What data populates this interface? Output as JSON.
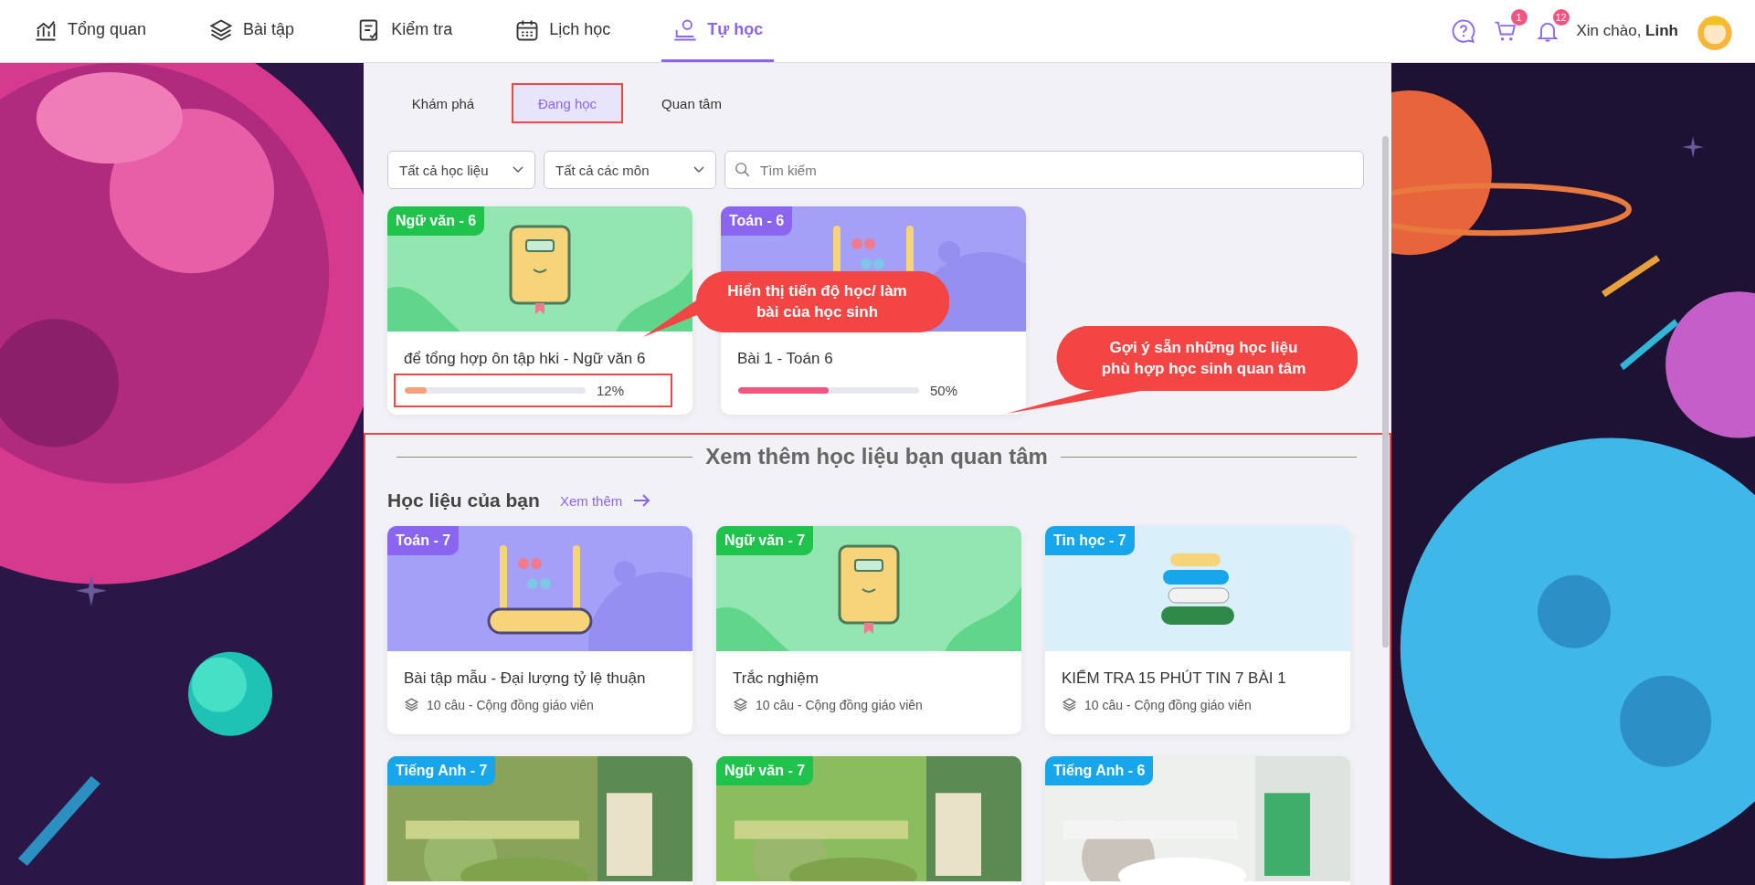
{
  "nav": {
    "items": [
      {
        "label": "Tổng quan",
        "kind": "chart",
        "selected": false
      },
      {
        "label": "Bài tập",
        "kind": "layers",
        "selected": false
      },
      {
        "label": "Kiểm tra",
        "kind": "test",
        "selected": false
      },
      {
        "label": "Lịch học",
        "kind": "calendar",
        "selected": false
      },
      {
        "label": "Tự học",
        "kind": "self",
        "selected": true
      }
    ],
    "cart_count": "1",
    "notification_count": "12",
    "greeting": "Xin chào,",
    "user_name": "Linh"
  },
  "tabs": [
    {
      "label": "Khám phá",
      "selected": false,
      "highlighted": false
    },
    {
      "label": "Đang học",
      "selected": true,
      "highlighted": true
    },
    {
      "label": "Quan tâm",
      "selected": false,
      "highlighted": false
    }
  ],
  "filters": [
    "Tất cả học liệu",
    "Tất cả các môn"
  ],
  "search": {
    "placeholder": "Tìm kiếm"
  },
  "in_progress": [
    {
      "subject": "Ngữ văn - 6",
      "color": "#1fc24a",
      "kind": "book",
      "title": "để tổng hợp ôn tập hki - Ngữ văn 6",
      "progress": {
        "level": 0.12,
        "reading": "12%",
        "color": "#f7a07f",
        "highlighted": true
      }
    },
    {
      "subject": "Toán - 6",
      "color": "#8a66f0",
      "kind": "abacus",
      "title": "Bài 1 - Toán 6",
      "progress": {
        "level": 0.5,
        "reading": "50%",
        "color": "#f2557f",
        "highlighted": false
      }
    }
  ],
  "callouts": [
    "Hiển thị tiến độ học/ làm bài của học sinh",
    "Gợi ý sẵn những học liệu phù hợp học sinh quan tâm"
  ],
  "suggestions": {
    "highlighted": true,
    "heading": "Xem thêm học liệu bạn quan tâm",
    "subheading": "Học liệu của bạn",
    "see_more": "Xem thêm",
    "items": [
      {
        "subject": "Toán - 7",
        "color": "#8a66f0",
        "kind": "abacus",
        "title": "Bài tập mẫu - Đại lượng tỷ lệ thuận",
        "meta": "10 câu - Cộng đồng giáo viên"
      },
      {
        "subject": "Ngữ văn - 7",
        "color": "#1fc24a",
        "kind": "book",
        "title": "Trắc nghiệm",
        "meta": "10 câu - Cộng đồng giáo viên"
      },
      {
        "subject": "Tin học - 7",
        "color": "#16a6ec",
        "kind": "books",
        "title": "KIỂM TRA 15 PHÚT TIN 7 BÀI 1",
        "meta": "10 câu - Cộng đồng giáo viên"
      },
      {
        "subject": "Tiếng Anh - 7",
        "color": "#16a6ec",
        "kind": "picture"
      },
      {
        "subject": "Ngữ văn - 7",
        "color": "#1fc24a",
        "kind": "picture"
      },
      {
        "subject": "Tiếng Anh - 6",
        "color": "#16a6ec",
        "kind": "picture"
      }
    ]
  }
}
